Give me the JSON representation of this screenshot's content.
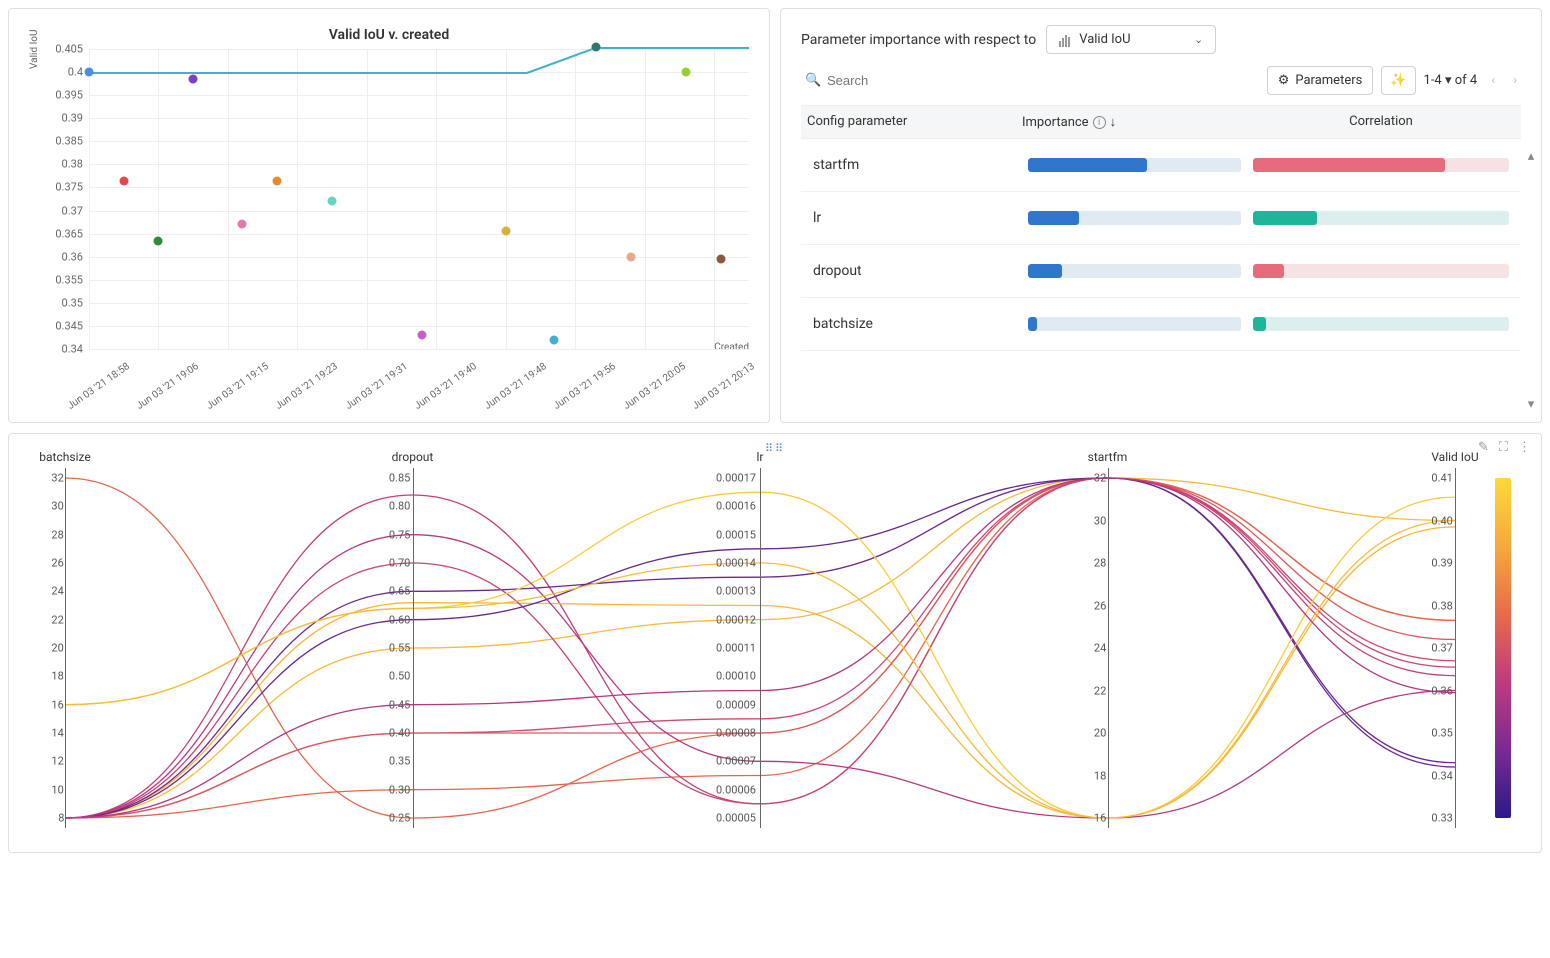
{
  "scatter": {
    "title": "Valid IoU v. created",
    "ylabel": "Valid IoU",
    "xlabel": "Created"
  },
  "importance": {
    "heading": "Parameter importance with respect to",
    "metric": "Valid IoU",
    "searchPlaceholder": "Search",
    "paramsBtn": "Parameters",
    "pager": "1-4",
    "pagerOf": "of 4",
    "col_param": "Config parameter",
    "col_imp": "Importance",
    "col_corr": "Correlation"
  },
  "params": {
    "p0": "startfm",
    "p1": "lr",
    "p2": "dropout",
    "p3": "batchsize"
  },
  "par": {
    "ax0": "batchsize",
    "ax1": "dropout",
    "ax2": "lr",
    "ax3": "startfm",
    "ax4": "Valid IoU"
  },
  "chart_data": {
    "scatter": {
      "type": "scatter",
      "title": "Valid IoU v. created",
      "xlabel": "Created",
      "ylabel": "Valid IoU",
      "ylim": [
        0.34,
        0.405
      ],
      "x_categories": [
        "Jun 03 '21 18:58",
        "Jun 03 '21 19:06",
        "Jun 03 '21 19:15",
        "Jun 03 '21 19:23",
        "Jun 03 '21 19:31",
        "Jun 03 '21 19:40",
        "Jun 03 '21 19:48",
        "Jun 03 '21 19:56",
        "Jun 03 '21 20:05",
        "Jun 03 '21 20:13"
      ],
      "points": [
        {
          "x_index": 0,
          "y": 0.4,
          "color": "#4a90e2"
        },
        {
          "x_index": 0.5,
          "y": 0.3765,
          "color": "#e24a4a"
        },
        {
          "x_index": 1.0,
          "y": 0.3635,
          "color": "#2e8b3d"
        },
        {
          "x_index": 1.5,
          "y": 0.3985,
          "color": "#7a3fc9"
        },
        {
          "x_index": 2.2,
          "y": 0.367,
          "color": "#e678b0"
        },
        {
          "x_index": 2.7,
          "y": 0.3765,
          "color": "#e68a2e"
        },
        {
          "x_index": 3.5,
          "y": 0.372,
          "color": "#63d6c1"
        },
        {
          "x_index": 4.8,
          "y": 0.343,
          "color": "#c85cc8"
        },
        {
          "x_index": 6.0,
          "y": 0.3655,
          "color": "#d6b23c"
        },
        {
          "x_index": 6.7,
          "y": 0.342,
          "color": "#3fb1c9"
        },
        {
          "x_index": 7.3,
          "y": 0.4055,
          "color": "#2a7a6e"
        },
        {
          "x_index": 7.8,
          "y": 0.36,
          "color": "#e6a98a"
        },
        {
          "x_index": 8.6,
          "y": 0.4,
          "color": "#9acd32"
        },
        {
          "x_index": 9.1,
          "y": 0.3595,
          "color": "#8b5a3c"
        }
      ],
      "best_line": [
        {
          "x_index": 0,
          "y": 0.4
        },
        {
          "x_index": 6.3,
          "y": 0.4
        },
        {
          "x_index": 7.3,
          "y": 0.4055
        },
        {
          "x_index": 9.5,
          "y": 0.4055
        }
      ]
    },
    "importance": {
      "type": "bar",
      "metric": "Valid IoU",
      "rows": [
        {
          "param": "startfm",
          "importance": 0.56,
          "correlation": -0.75
        },
        {
          "param": "lr",
          "importance": 0.24,
          "correlation": 0.25
        },
        {
          "param": "dropout",
          "importance": 0.16,
          "correlation": -0.12
        },
        {
          "param": "batchsize",
          "importance": 0.04,
          "correlation": 0.05
        }
      ]
    },
    "parallel": {
      "type": "parallel",
      "color_by": "Valid IoU",
      "axes": [
        {
          "name": "batchsize",
          "range": [
            8,
            32
          ],
          "ticks": [
            8,
            10,
            12,
            14,
            16,
            18,
            20,
            22,
            24,
            26,
            28,
            30,
            32
          ]
        },
        {
          "name": "dropout",
          "range": [
            0.25,
            0.85
          ],
          "ticks": [
            0.25,
            0.3,
            0.35,
            0.4,
            0.45,
            0.5,
            0.55,
            0.6,
            0.65,
            0.7,
            0.75,
            0.8,
            0.85
          ]
        },
        {
          "name": "lr",
          "range": [
            5e-05,
            0.00017
          ],
          "ticks": [
            5e-05,
            6e-05,
            7e-05,
            8e-05,
            9e-05,
            0.0001,
            0.00011,
            0.00012,
            0.00013,
            0.00014,
            0.00015,
            0.00016,
            0.00017
          ]
        },
        {
          "name": "startfm",
          "range": [
            16,
            32
          ],
          "ticks": [
            16,
            18,
            20,
            22,
            24,
            26,
            28,
            30,
            32
          ]
        },
        {
          "name": "Valid IoU",
          "range": [
            0.33,
            0.41
          ],
          "ticks": [
            0.33,
            0.34,
            0.35,
            0.36,
            0.37,
            0.38,
            0.39,
            0.4,
            0.41
          ]
        }
      ],
      "runs": [
        {
          "batchsize": 8,
          "dropout": 0.55,
          "lr": 0.00012,
          "startfm": 32,
          "Valid IoU": 0.4
        },
        {
          "batchsize": 8,
          "dropout": 0.3,
          "lr": 6.5e-05,
          "startfm": 32,
          "Valid IoU": 0.3765
        },
        {
          "batchsize": 8,
          "dropout": 0.82,
          "lr": 5.5e-05,
          "startfm": 32,
          "Valid IoU": 0.3635
        },
        {
          "batchsize": 8,
          "dropout": 0.63,
          "lr": 0.000125,
          "startfm": 16,
          "Valid IoU": 0.3985
        },
        {
          "batchsize": 8,
          "dropout": 0.4,
          "lr": 8.5e-05,
          "startfm": 32,
          "Valid IoU": 0.367
        },
        {
          "batchsize": 32,
          "dropout": 0.25,
          "lr": 8e-05,
          "startfm": 32,
          "Valid IoU": 0.3765
        },
        {
          "batchsize": 8,
          "dropout": 0.4,
          "lr": 8e-05,
          "startfm": 32,
          "Valid IoU": 0.372
        },
        {
          "batchsize": 8,
          "dropout": 0.65,
          "lr": 0.000135,
          "startfm": 32,
          "Valid IoU": 0.343
        },
        {
          "batchsize": 8,
          "dropout": 0.7,
          "lr": 5.5e-05,
          "startfm": 32,
          "Valid IoU": 0.3655
        },
        {
          "batchsize": 8,
          "dropout": 0.6,
          "lr": 0.000145,
          "startfm": 32,
          "Valid IoU": 0.342
        },
        {
          "batchsize": 16,
          "dropout": 0.62,
          "lr": 0.000165,
          "startfm": 16,
          "Valid IoU": 0.4055
        },
        {
          "batchsize": 8,
          "dropout": 0.75,
          "lr": 7e-05,
          "startfm": 16,
          "Valid IoU": 0.36
        },
        {
          "batchsize": 16,
          "dropout": 0.62,
          "lr": 0.00014,
          "startfm": 16,
          "Valid IoU": 0.4
        },
        {
          "batchsize": 8,
          "dropout": 0.45,
          "lr": 9.5e-05,
          "startfm": 32,
          "Valid IoU": 0.3595
        }
      ]
    }
  }
}
